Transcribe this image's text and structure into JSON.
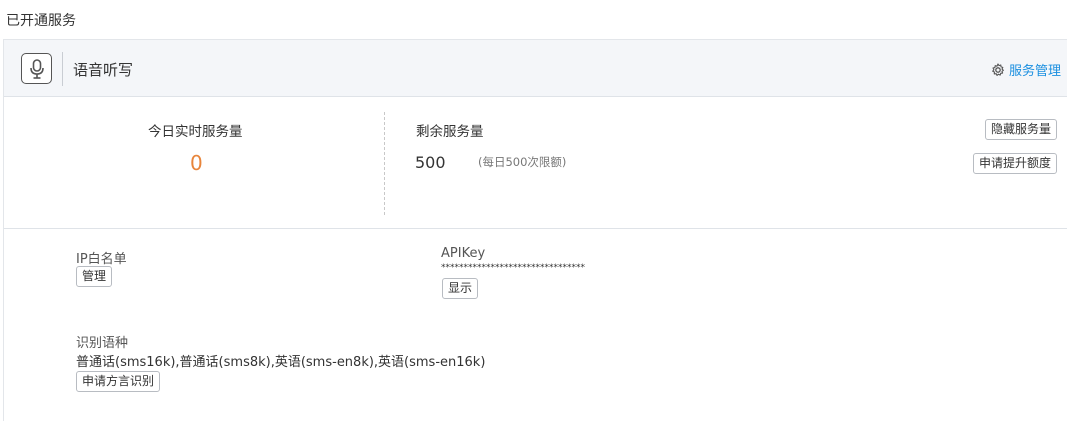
{
  "page": {
    "title": "已开通服务"
  },
  "service": {
    "icon": "microphone-icon",
    "name": "语音听写",
    "manage_label": "服务管理",
    "manage_icon": "gear-icon",
    "accent_color": "#1a8fe0"
  },
  "stats": {
    "today_label": "今日实时服务量",
    "today_value": "0",
    "today_color": "#e8853b",
    "remaining_label": "剩余服务量",
    "remaining_value": "500",
    "remaining_note": "(每日500次限额)",
    "hide_button": "隐藏服务量",
    "raise_button": "申请提升额度"
  },
  "ip_whitelist": {
    "label": "IP白名单",
    "button": "管理"
  },
  "api_key": {
    "label": "APIKey",
    "masked": "********************************",
    "button": "显示"
  },
  "languages": {
    "label": "识别语种",
    "list": "普通话(sms16k),普通话(sms8k),英语(sms-en8k),英语(sms-en16k)",
    "button": "申请方言识别"
  }
}
